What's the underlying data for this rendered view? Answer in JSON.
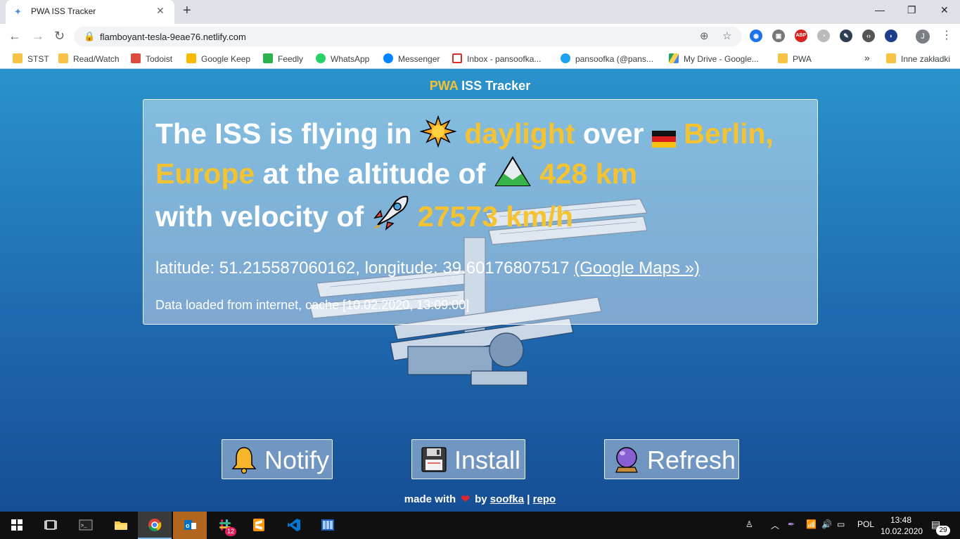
{
  "browser": {
    "tab_title": "PWA ISS Tracker",
    "tab_close": "✕",
    "new_tab": "+",
    "window_controls": {
      "minimize": "—",
      "maximize": "❐",
      "close": "✕"
    },
    "url": "flamboyant-tesla-9eae76.netlify.com",
    "profile_initial": "J",
    "abp_label": "ABP",
    "bookmarks": [
      {
        "label": "STST",
        "icon": "folder-icon",
        "color": "#f6c344"
      },
      {
        "label": "Read/Watch",
        "icon": "folder-icon",
        "color": "#f6c344"
      },
      {
        "label": "Todoist",
        "icon": "todoist-icon",
        "color": "#db4c3f"
      },
      {
        "label": "Google Keep",
        "icon": "keep-icon",
        "color": "#f9ba00"
      },
      {
        "label": "Feedly",
        "icon": "feedly-icon",
        "color": "#2bb24c"
      },
      {
        "label": "WhatsApp",
        "icon": "whatsapp-icon",
        "color": "#25d366"
      },
      {
        "label": "Messenger",
        "icon": "messenger-icon",
        "color": "#0084ff"
      },
      {
        "label": "Inbox - pansoofka...",
        "icon": "gmail-icon",
        "color": "#d93025"
      },
      {
        "label": "pansoofka (@pans...",
        "icon": "twitter-icon",
        "color": "#1da1f2"
      },
      {
        "label": "My Drive - Google...",
        "icon": "drive-icon",
        "color": "#1fa463"
      },
      {
        "label": "PWA",
        "icon": "folder-icon",
        "color": "#f6c344"
      }
    ],
    "bookmarks_overflow": "»",
    "other_bookmarks": "Inne zakładki"
  },
  "app": {
    "title_highlight": "PWA",
    "title_rest": " ISS Tracker",
    "headline": {
      "p1": "The ISS is flying in",
      "daylight": "daylight",
      "p2": "over",
      "location": "Berlin, Europe",
      "p3": "at the altitude of",
      "altitude": "428 km",
      "p4": "with velocity of",
      "velocity": "27573 km/h"
    },
    "coordinates": "latitude: 51.215587060162, longitude: 39.60176807517",
    "maps_link": "(Google Maps »)",
    "cache_status": "Data loaded from internet, cache [10.02.2020, 13:09:00]",
    "buttons": {
      "notify": "Notify",
      "install": "Install",
      "refresh": "Refresh"
    },
    "footer": {
      "made_with": "made with",
      "heart": "❤",
      "by": "by",
      "author": "soofka",
      "separator": "|",
      "repo": "repo"
    }
  },
  "taskbar": {
    "language": "POL",
    "time": "13:48",
    "date": "10.02.2020",
    "notifications": "29",
    "outlook_badge": "12"
  }
}
